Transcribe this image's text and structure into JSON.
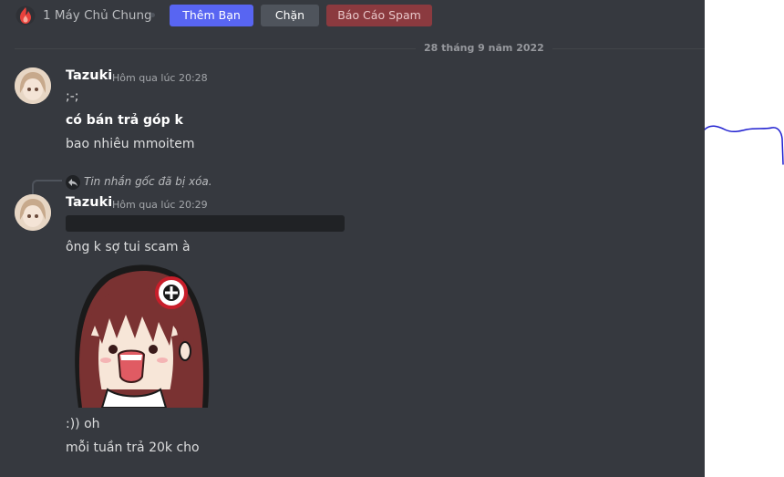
{
  "topbar": {
    "mutual_servers": "1 Máy Chủ Chung",
    "add_friend_label": "Thêm Bạn",
    "block_label": "Chặn",
    "report_spam_label": "Báo Cáo Spam"
  },
  "date_divider": "28 tháng 9 năm 2022",
  "messages": [
    {
      "author": "Tazuki",
      "timestamp": "Hôm qua lúc 20:28",
      "lines": [
        ";-;",
        "có bán trả góp k",
        "bao nhiêu mmoitem"
      ]
    },
    {
      "reply_notice": "Tin nhắn gốc đã bị xóa.",
      "author": "Tazuki",
      "timestamp": "Hôm qua lúc 20:29",
      "lines": [
        "ông k sợ tui scam à",
        ":)) oh",
        "mỗi tuần trả 20k cho"
      ]
    }
  ],
  "colors": {
    "background": "#36393f",
    "accent": "#5865f2",
    "danger": "#8b3a3f",
    "annotation": "#1f1fd0"
  },
  "icons": {
    "server": "fire-icon",
    "reply": "reply-arrow-icon",
    "sticker": "anime-girl-sticker"
  }
}
